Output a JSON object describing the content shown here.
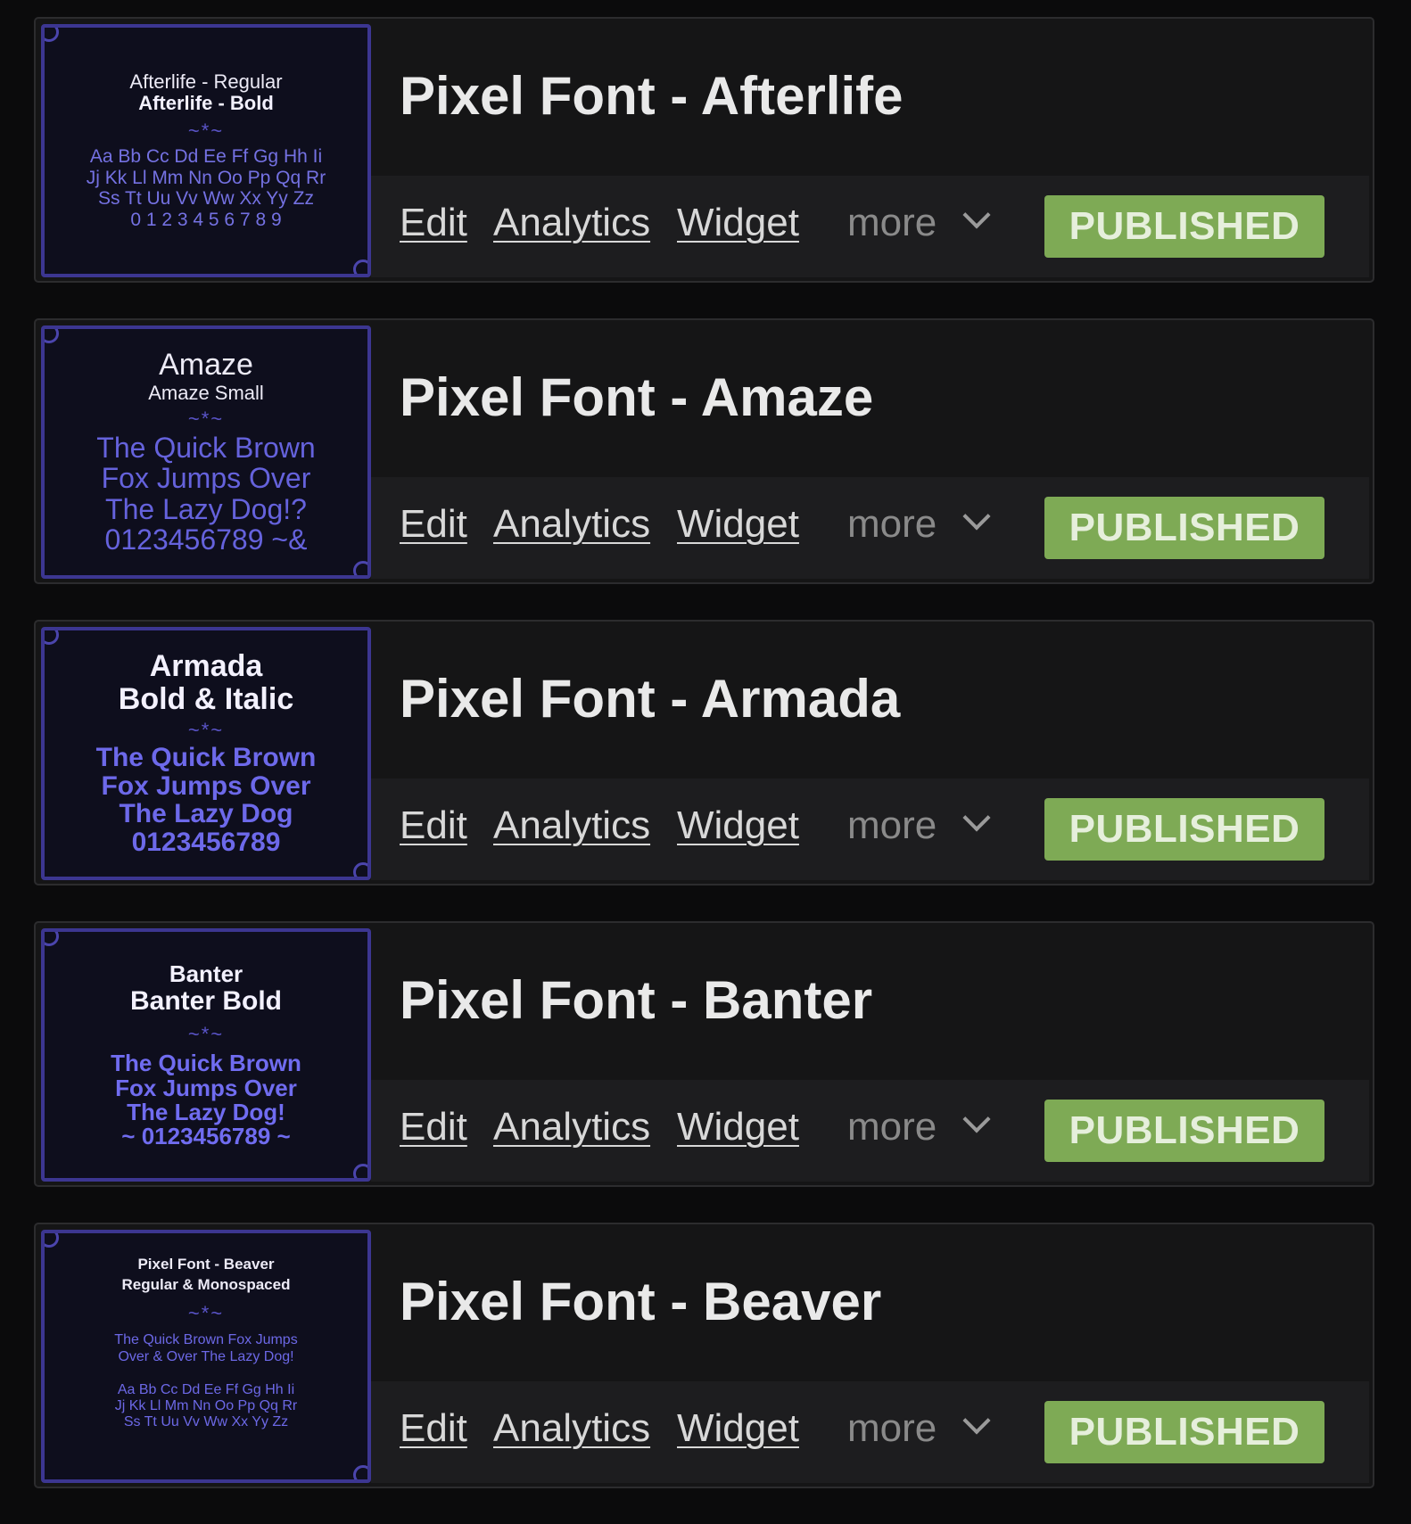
{
  "fonts": [
    {
      "title": "Pixel Font - Afterlife",
      "thumb": {
        "line1": "Afterlife - Regular",
        "line2": "Afterlife - Bold",
        "ornament": "~*~",
        "sample": "Aa Bb Cc Dd Ee Ff Gg Hh Ii\nJj Kk Ll Mm Nn Oo Pp Qq Rr\nSs Tt Uu Vv Ww Xx Yy Zz\n0 1 2 3 4 5 6 7 8 9"
      },
      "actions": {
        "edit": "Edit",
        "analytics": "Analytics",
        "widget": "Widget",
        "more": "more"
      },
      "status": "PUBLISHED"
    },
    {
      "title": "Pixel Font - Amaze",
      "thumb": {
        "line1": "Amaze",
        "line2": "Amaze Small",
        "ornament": "~*~",
        "sample": "The Quick Brown\nFox Jumps Over\nThe Lazy Dog!?\n0123456789 ~&"
      },
      "actions": {
        "edit": "Edit",
        "analytics": "Analytics",
        "widget": "Widget",
        "more": "more"
      },
      "status": "PUBLISHED"
    },
    {
      "title": "Pixel Font - Armada",
      "thumb": {
        "line1": "Armada",
        "line2": "Bold & Italic",
        "ornament": "~*~",
        "sample": "The Quick Brown\nFox Jumps Over\nThe Lazy Dog\n0123456789"
      },
      "actions": {
        "edit": "Edit",
        "analytics": "Analytics",
        "widget": "Widget",
        "more": "more"
      },
      "status": "PUBLISHED"
    },
    {
      "title": "Pixel Font - Banter",
      "thumb": {
        "line1": "Banter",
        "line2": "Banter Bold",
        "ornament": "~*~",
        "sample": "The Quick Brown\nFox Jumps Over\nThe Lazy Dog!\n~ 0123456789 ~"
      },
      "actions": {
        "edit": "Edit",
        "analytics": "Analytics",
        "widget": "Widget",
        "more": "more"
      },
      "status": "PUBLISHED"
    },
    {
      "title": "Pixel Font - Beaver",
      "thumb": {
        "line1": "Pixel Font - Beaver",
        "line2": "Regular & Monospaced",
        "ornament": "~*~",
        "sample": "The Quick Brown Fox Jumps\nOver & Over The Lazy Dog!\n\nAa Bb Cc Dd Ee Ff Gg Hh Ii\nJj Kk Ll Mm Nn Oo Pp Qq Rr\nSs Tt Uu Vv Ww Xx Yy Zz"
      },
      "actions": {
        "edit": "Edit",
        "analytics": "Analytics",
        "widget": "Widget",
        "more": "more"
      },
      "status": "PUBLISHED"
    }
  ],
  "colors": {
    "background": "#0b0b0c",
    "card": "#151516",
    "actions_bar": "#1d1d1f",
    "published": "#7eaa55",
    "thumb_border": "#3c3691",
    "thumb_text": "#6e6ae6"
  },
  "icons": {
    "more": "chevron-down-icon",
    "thumb_corner": "ornament-corner-icon"
  }
}
